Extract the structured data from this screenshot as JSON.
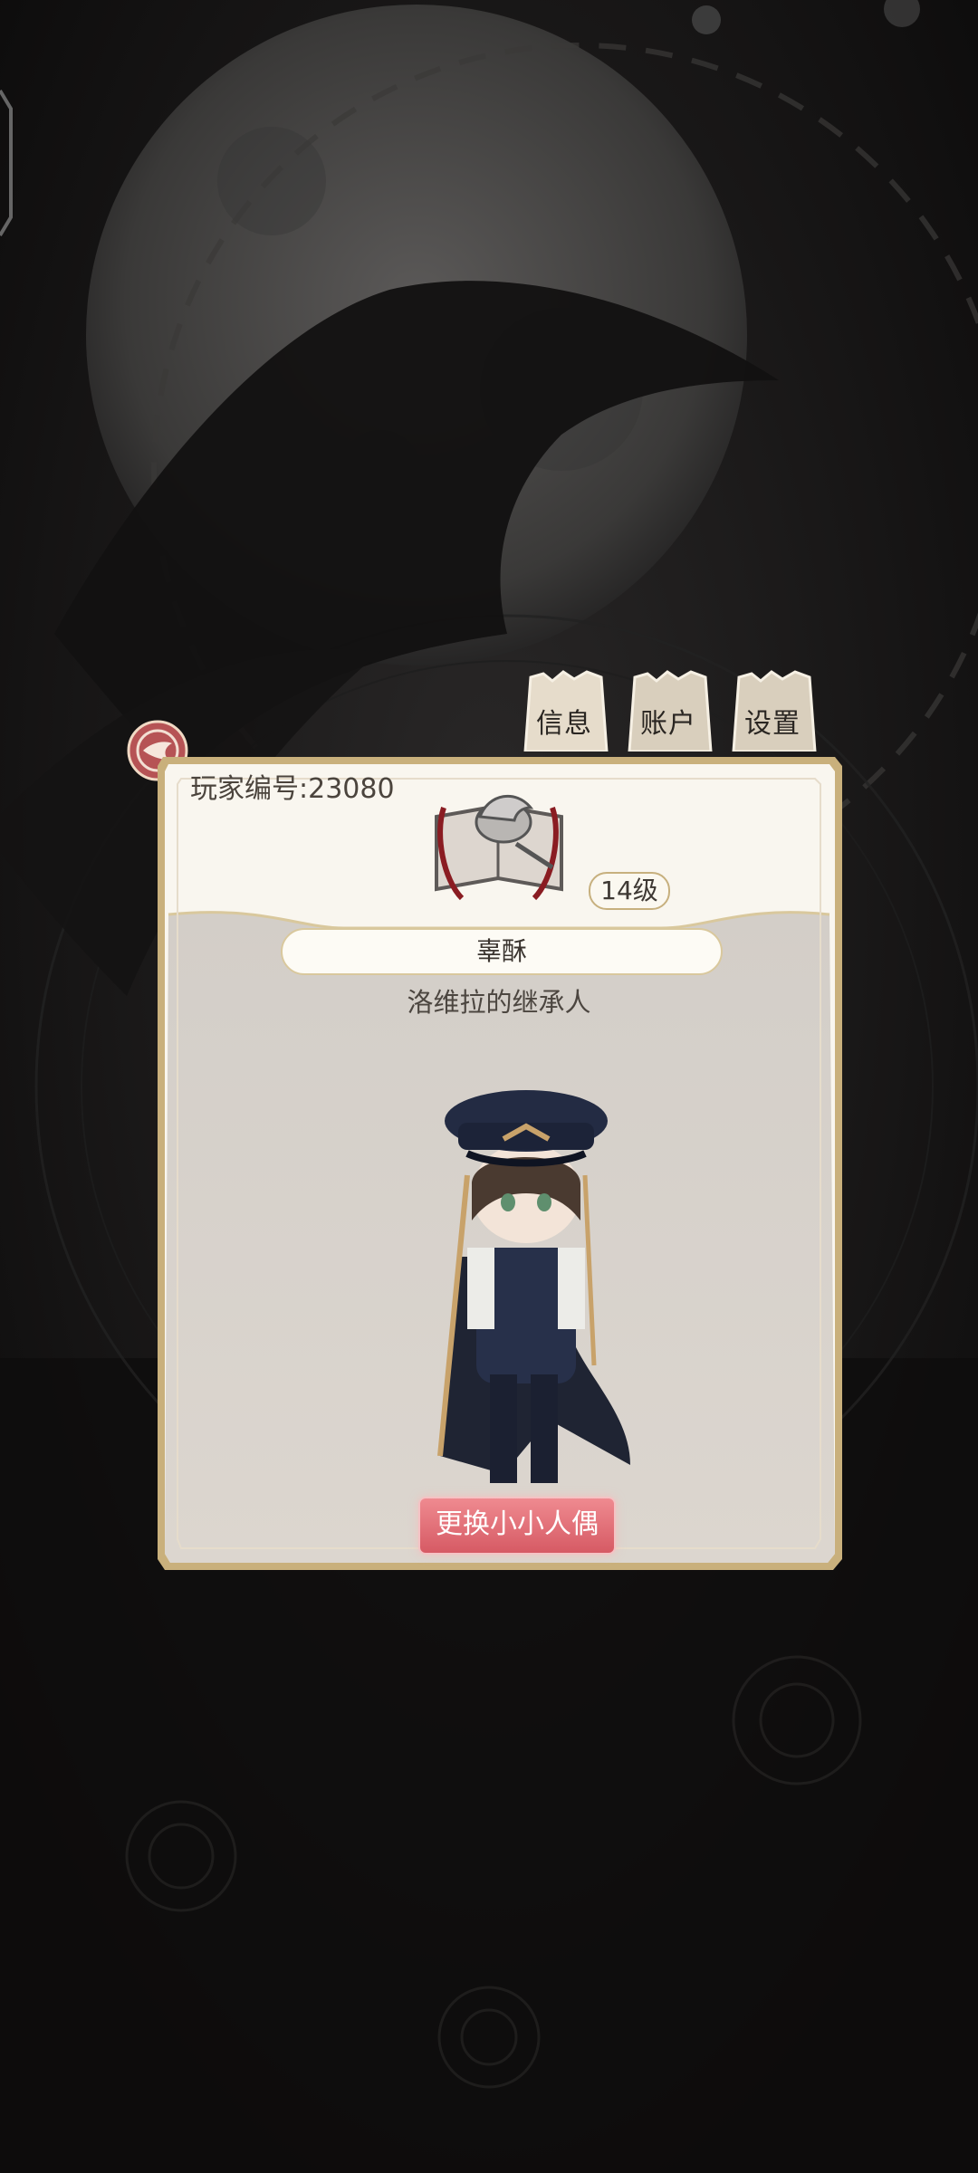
{
  "tabs": [
    {
      "label": "信息"
    },
    {
      "label": "账户"
    },
    {
      "label": "设置"
    }
  ],
  "profile": {
    "player_id_text": "玩家编号:23080",
    "level_text": "14级",
    "name": "辜酥",
    "title": "洛维拉的继承人",
    "change_doll_label": "更换小小人偶"
  },
  "icons": {
    "emblem": "back-emblem-icon",
    "crest": "raven-book-crest-icon"
  },
  "colors": {
    "background": "#0d0c0c",
    "panel_cream": "#f8f5ee",
    "panel_gray": "#d8d3cd",
    "gold_border": "#c9b07c",
    "button_pink": "#e36d76"
  }
}
